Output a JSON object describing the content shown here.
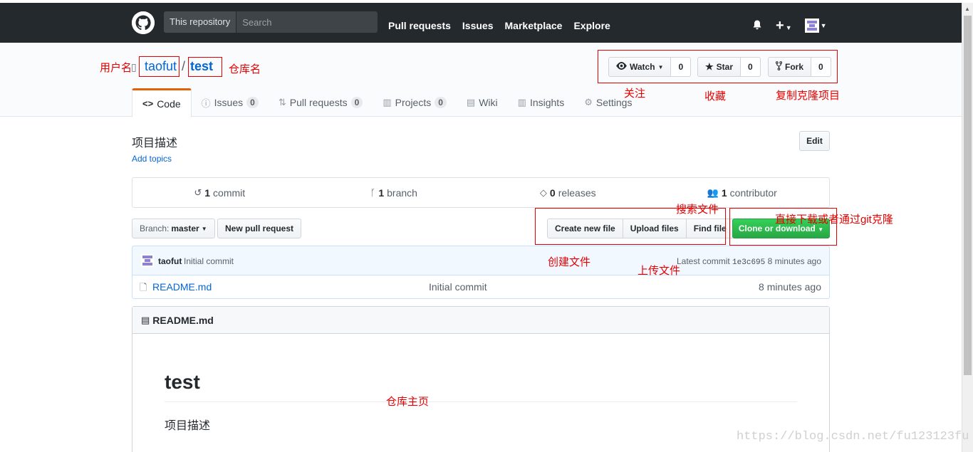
{
  "topbar": {
    "scope_label": "This repository",
    "search_placeholder": "Search",
    "nav": [
      "Pull requests",
      "Issues",
      "Marketplace",
      "Explore"
    ],
    "plus_label": "+"
  },
  "repo": {
    "owner": "taofut",
    "slash": "/",
    "name": "test"
  },
  "actions": {
    "watch_label": "Watch",
    "watch_count": "0",
    "star_label": "Star",
    "star_count": "0",
    "fork_label": "Fork",
    "fork_count": "0"
  },
  "tabs": [
    {
      "label": "Code",
      "icon": "code-icon",
      "count": ""
    },
    {
      "label": "Issues",
      "icon": "issue-icon",
      "count": "0"
    },
    {
      "label": "Pull requests",
      "icon": "pull-request-icon",
      "count": "0"
    },
    {
      "label": "Projects",
      "icon": "project-icon",
      "count": "0"
    },
    {
      "label": "Wiki",
      "icon": "book-icon",
      "count": ""
    },
    {
      "label": "Insights",
      "icon": "graph-icon",
      "count": ""
    },
    {
      "label": "Settings",
      "icon": "gear-icon",
      "count": ""
    }
  ],
  "description": {
    "text": "项目描述",
    "add_topics": "Add topics",
    "edit_label": "Edit"
  },
  "summary": {
    "commits_num": "1",
    "commits_label": "commit",
    "branches_num": "1",
    "branches_label": "branch",
    "releases_num": "0",
    "releases_label": "releases",
    "contributors_num": "1",
    "contributors_label": "contributor"
  },
  "filenav": {
    "branch_label": "Branch:",
    "branch_value": "master",
    "new_pr": "New pull request",
    "create_file": "Create new file",
    "upload_files": "Upload files",
    "find_file": "Find file",
    "clone": "Clone or download"
  },
  "latest_commit": {
    "author": "taofut",
    "message": "Initial commit",
    "prefix": "Latest commit",
    "sha": "1e3c695",
    "age": "8 minutes ago"
  },
  "files": [
    {
      "name": "README.md",
      "message": "Initial commit",
      "age": "8 minutes ago"
    }
  ],
  "readme": {
    "header": "README.md",
    "title": "test",
    "body": "项目描述"
  },
  "annotations": {
    "username": "用户名",
    "reponame": "仓库名",
    "watch": "关注",
    "star": "收藏",
    "fork": "复制克隆项目",
    "search_file": "搜索文件",
    "clone": "直接下载或者通过git克隆",
    "create_file": "创建文件",
    "upload_file": "上传文件",
    "home": "仓库主页"
  },
  "watermark": "https://blog.csdn.net/fu123123fu",
  "colors": {
    "header_bg": "#24292e",
    "link": "#0366d6",
    "clone_green": "#28a745",
    "annotation_red": "#e60000",
    "tab_accent": "#e36209"
  }
}
